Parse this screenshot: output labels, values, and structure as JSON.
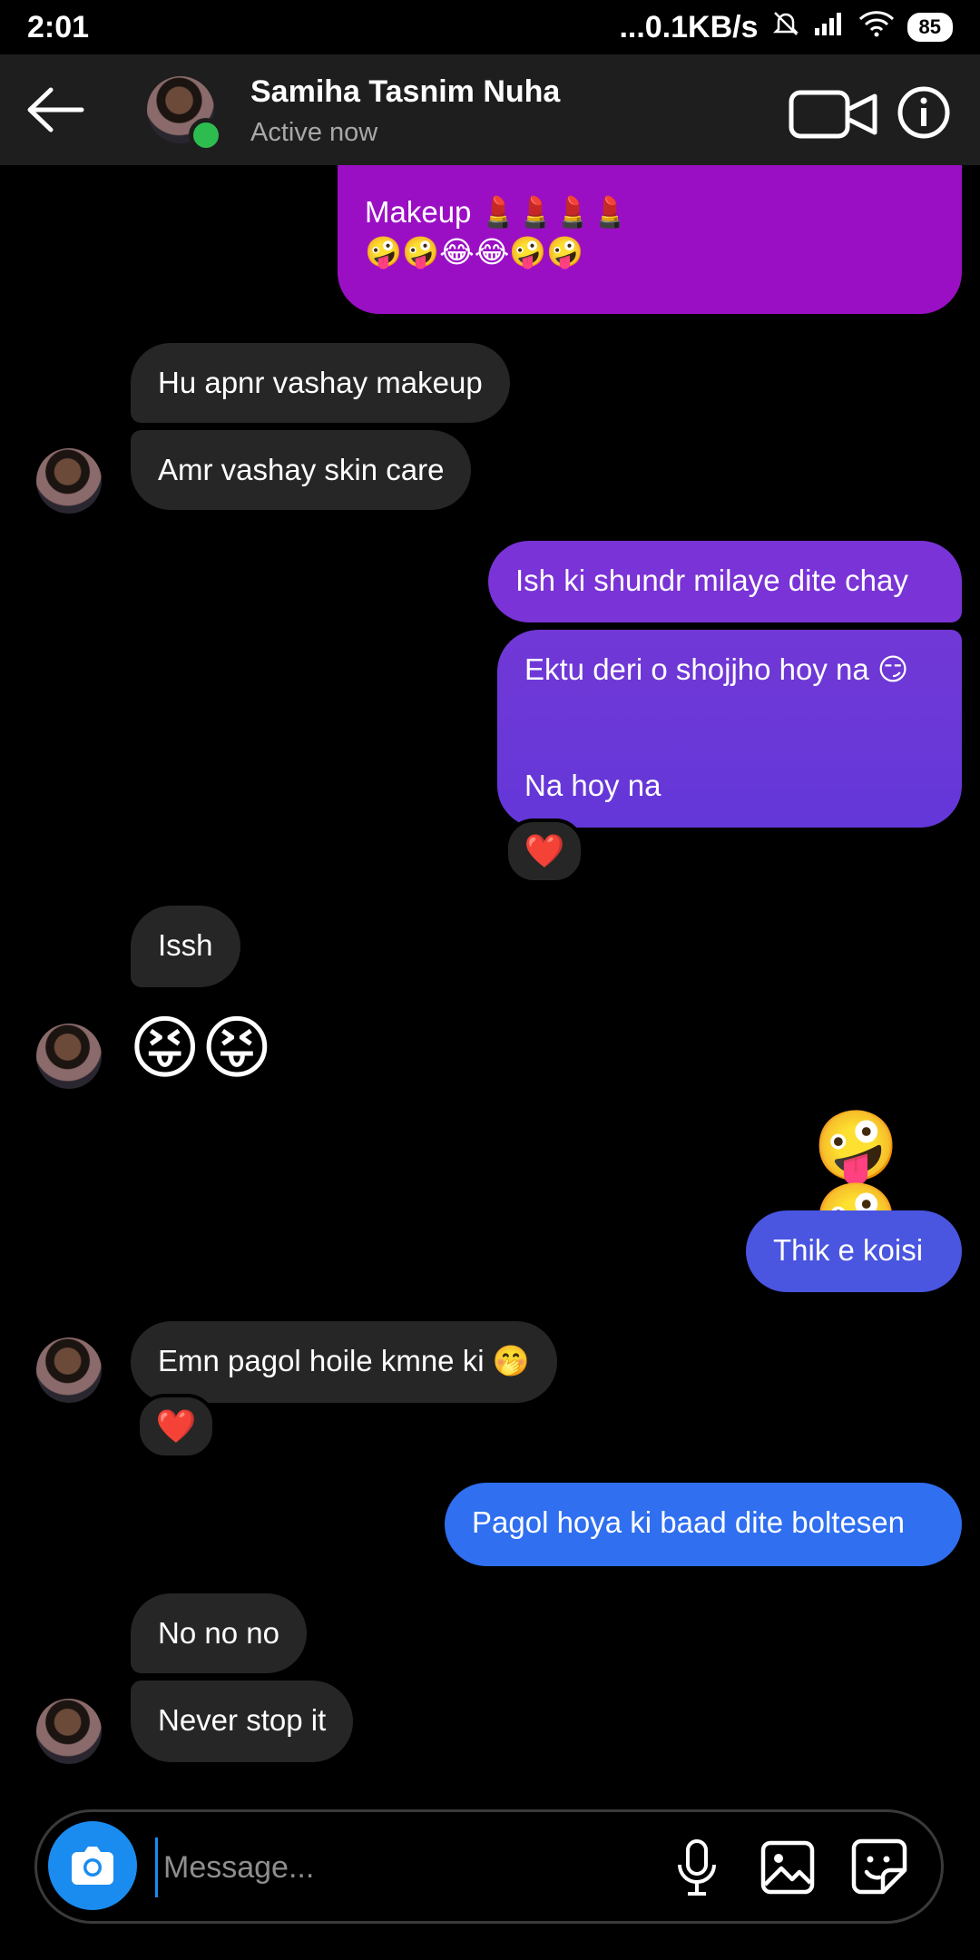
{
  "status_bar": {
    "time": "2:01",
    "network": "...0.1KB/s",
    "battery": "85"
  },
  "header": {
    "contact_name": "Samiha Tasnim Nuha",
    "status": "Active now"
  },
  "messages": [
    {
      "side": "out",
      "text_line1": "Makeup 💄💄💄💄",
      "text_line2": "🤪🤪😂😂🤪🤪"
    },
    {
      "side": "in",
      "text": "Hu apnr vashay makeup"
    },
    {
      "side": "in",
      "text": "Amr vashay skin care"
    },
    {
      "side": "out",
      "text": "Ish ki shundr milaye dite chay"
    },
    {
      "side": "out",
      "text_line1": "Ektu deri o shojjho hoy na 😏",
      "text_line2": "Na hoy na",
      "reaction": "❤️"
    },
    {
      "side": "in",
      "text": "Issh"
    },
    {
      "side": "in",
      "text": "😝😝"
    },
    {
      "side": "out",
      "text": "🤪🤪"
    },
    {
      "side": "out",
      "text": "Thik e koisi"
    },
    {
      "side": "in",
      "text": "Emn pagol hoile kmne ki 🤭",
      "reaction": "❤️"
    },
    {
      "side": "out",
      "text": "Pagol hoya ki baad dite boltesen"
    },
    {
      "side": "in",
      "text": "No no no"
    },
    {
      "side": "in",
      "text": "Never stop it"
    }
  ],
  "composer": {
    "placeholder": "Message..."
  },
  "colors": {
    "bubble_magenta": "#9b0fc4",
    "bubble_purple": "#7a33d6",
    "bubble_indigo": "#4a55e0",
    "bubble_blue": "#2f6ff0",
    "incoming": "#262626",
    "accent_blue": "#1a8cf0"
  },
  "icons": [
    "back-arrow-icon",
    "video-call-icon",
    "info-icon",
    "camera-icon",
    "microphone-icon",
    "gallery-icon",
    "sticker-icon"
  ]
}
